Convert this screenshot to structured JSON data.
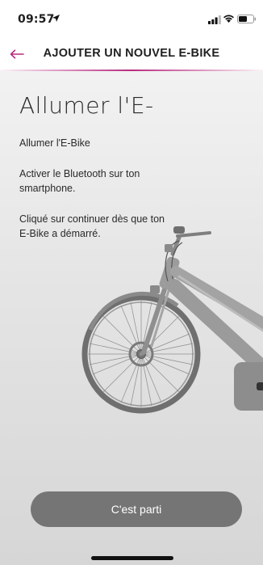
{
  "status_bar": {
    "time": "09:57"
  },
  "header": {
    "title": "AJOUTER UN NOUVEL E-BIKE"
  },
  "main": {
    "title": "Allumer l'E-",
    "step_text": "Allumer l'E-Bike",
    "bluetooth_text": "Activer le Bluetooth sur ton smartphone.",
    "continue_text": "Cliqué sur continuer dès que ton E-Bike a démarré.",
    "bike_image": "e-bike-illustration"
  },
  "footer": {
    "button_label": "C'est parti"
  },
  "colors": {
    "accent": "#b82b7f",
    "button_bg": "#757575",
    "content_bg": "#e8e8e8"
  }
}
